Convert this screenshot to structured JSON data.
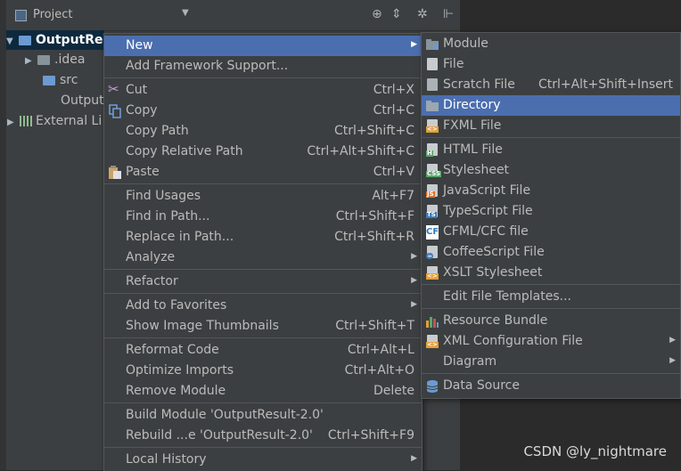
{
  "project_panel": {
    "title": "Project",
    "tree": [
      {
        "label": "OutputRe",
        "selected": true,
        "expanded": true
      },
      {
        "label": ".idea"
      },
      {
        "label": "src"
      },
      {
        "label": "Output"
      },
      {
        "label": "External Li"
      }
    ]
  },
  "context_menu": {
    "items": [
      {
        "label": "New",
        "shortcut": "",
        "submenu": true,
        "highlighted": true
      },
      {
        "label": "Add Framework Support...",
        "shortcut": ""
      },
      {
        "label": "Cut",
        "shortcut": "Ctrl+X",
        "icon": "scissors-icon"
      },
      {
        "label": "Copy",
        "shortcut": "Ctrl+C",
        "icon": "copy-icon"
      },
      {
        "label": "Copy Path",
        "shortcut": "Ctrl+Shift+C"
      },
      {
        "label": "Copy Relative Path",
        "shortcut": "Ctrl+Alt+Shift+C"
      },
      {
        "label": "Paste",
        "shortcut": "Ctrl+V",
        "icon": "paste-icon"
      },
      {
        "label": "Find Usages",
        "shortcut": "Alt+F7"
      },
      {
        "label": "Find in Path...",
        "shortcut": "Ctrl+Shift+F"
      },
      {
        "label": "Replace in Path...",
        "shortcut": "Ctrl+Shift+R"
      },
      {
        "label": "Analyze",
        "shortcut": "",
        "submenu": true
      },
      {
        "label": "Refactor",
        "shortcut": "",
        "submenu": true
      },
      {
        "label": "Add to Favorites",
        "shortcut": "",
        "submenu": true
      },
      {
        "label": "Show Image Thumbnails",
        "shortcut": "Ctrl+Shift+T"
      },
      {
        "label": "Reformat Code",
        "shortcut": "Ctrl+Alt+L"
      },
      {
        "label": "Optimize Imports",
        "shortcut": "Ctrl+Alt+O"
      },
      {
        "label": "Remove Module",
        "shortcut": "Delete"
      },
      {
        "label": "Build Module 'OutputResult-2.0'",
        "shortcut": ""
      },
      {
        "label": "Rebuild ...e 'OutputResult-2.0'",
        "shortcut": "Ctrl+Shift+F9"
      },
      {
        "label": "Local History",
        "shortcut": "",
        "submenu": true
      }
    ]
  },
  "new_submenu": {
    "items": [
      {
        "label": "Module",
        "shortcut": "",
        "icon": "module-icon"
      },
      {
        "label": "File",
        "shortcut": "",
        "icon": "file-icon"
      },
      {
        "label": "Scratch File",
        "shortcut": "Ctrl+Alt+Shift+Insert",
        "icon": "scratch-file-icon"
      },
      {
        "label": "Directory",
        "shortcut": "",
        "icon": "folder-icon",
        "highlighted": true
      },
      {
        "label": "FXML File",
        "shortcut": "",
        "icon": "fxml-file-icon"
      },
      {
        "label": "HTML File",
        "shortcut": "",
        "icon": "html-file-icon"
      },
      {
        "label": "Stylesheet",
        "shortcut": "",
        "icon": "css-file-icon"
      },
      {
        "label": "JavaScript File",
        "shortcut": "",
        "icon": "js-file-icon"
      },
      {
        "label": "TypeScript File",
        "shortcut": "",
        "icon": "ts-file-icon"
      },
      {
        "label": "CFML/CFC file",
        "shortcut": "",
        "icon": "cfml-file-icon"
      },
      {
        "label": "CoffeeScript File",
        "shortcut": "",
        "icon": "coffeescript-file-icon"
      },
      {
        "label": "XSLT Stylesheet",
        "shortcut": "",
        "icon": "xslt-file-icon"
      },
      {
        "label": "Edit File Templates...",
        "shortcut": ""
      },
      {
        "label": "Resource Bundle",
        "shortcut": "",
        "icon": "resource-bundle-icon"
      },
      {
        "label": "XML Configuration File",
        "shortcut": "",
        "icon": "xml-file-icon",
        "submenu": true
      },
      {
        "label": "Diagram",
        "shortcut": "",
        "submenu": true
      },
      {
        "label": "Data Source",
        "shortcut": "",
        "icon": "database-icon"
      }
    ]
  },
  "watermark": "CSDN @ly_nightmare",
  "colors": {
    "panel_bg": "#3c3f41",
    "highlight": "#4b6eaf",
    "selection": "#0d293e",
    "text": "#bbbbbb"
  }
}
